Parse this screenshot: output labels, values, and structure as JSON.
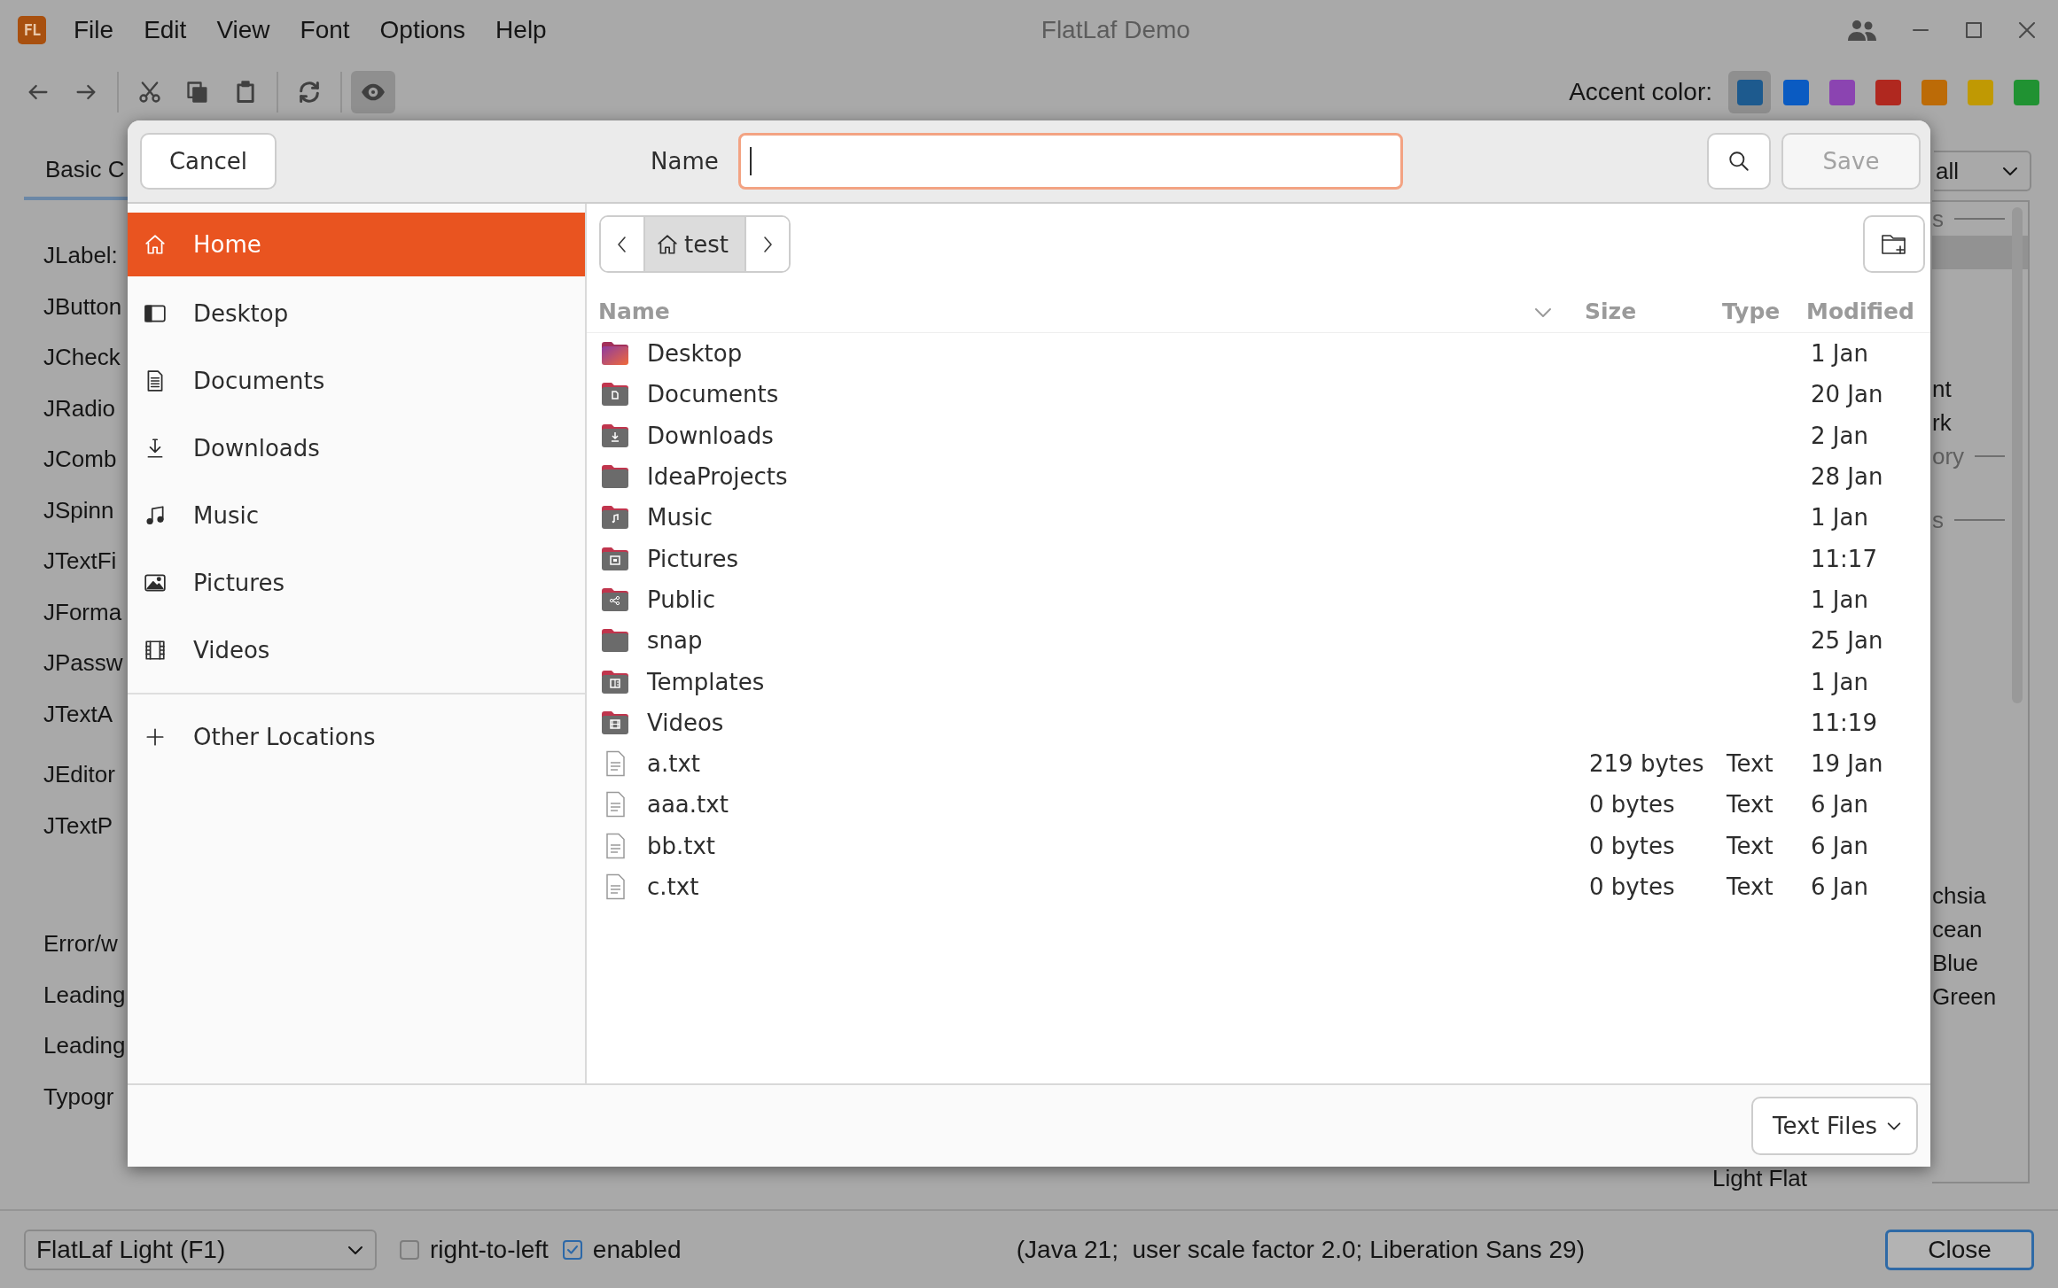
{
  "window": {
    "title": "FlatLaf Demo",
    "logo": "FL"
  },
  "menu": [
    "File",
    "Edit",
    "View",
    "Font",
    "Options",
    "Help"
  ],
  "toolbar": [
    [
      {
        "kind": "back",
        "selected": false
      },
      {
        "kind": "forward",
        "selected": false
      }
    ],
    [
      {
        "kind": "cut",
        "selected": false
      },
      {
        "kind": "copy",
        "selected": false
      },
      {
        "kind": "paste",
        "selected": false
      }
    ],
    [
      {
        "kind": "refresh",
        "selected": false
      }
    ],
    [
      {
        "kind": "eye",
        "selected": true
      }
    ]
  ],
  "accent": {
    "label": "Accent color:",
    "colors": [
      {
        "color": "#1d5a8e",
        "selected": true
      },
      {
        "color": "#0a5bc2",
        "selected": false
      },
      {
        "color": "#8b44b1",
        "selected": false
      },
      {
        "color": "#b0281f",
        "selected": false
      },
      {
        "color": "#bc6b07",
        "selected": false
      },
      {
        "color": "#c09903",
        "selected": false
      },
      {
        "color": "#209232",
        "selected": false
      }
    ]
  },
  "tabs": [
    {
      "label": "Basic C",
      "selected": true
    }
  ],
  "labels": [
    [
      "JLabel:",
      "JButton",
      "JCheck",
      "JRadio",
      "JComb",
      "JSpinn",
      "JTextFi",
      "JForma",
      "JPassw",
      "JTextA"
    ],
    [
      "JEditor",
      "JTextP"
    ],
    [
      "Error/w",
      "Leading",
      "Leading"
    ],
    [
      "Typogr"
    ]
  ],
  "right_panel": {
    "combo": "all",
    "groups": [
      [
        {
          "kind": "heading",
          "text": "s",
          "selected": false
        },
        {
          "kind": "item",
          "selected": true
        }
      ],
      [
        {
          "kind": "item",
          "text": "nt",
          "selected": false
        },
        {
          "kind": "item",
          "text": "rk",
          "selected": false
        },
        {
          "kind": "heading",
          "text": "ory",
          "selected": false
        }
      ],
      [
        {
          "kind": "heading",
          "text": "s",
          "selected": false
        }
      ],
      [
        {
          "kind": "item",
          "text": "chsia",
          "selected": false
        },
        {
          "kind": "item",
          "text": "cean",
          "selected": false
        },
        {
          "kind": "item",
          "text": "Blue",
          "selected": false
        },
        {
          "kind": "item",
          "text": "Green",
          "selected": false
        }
      ]
    ],
    "footer_item": "Light Flat"
  },
  "status_bar": {
    "theme": "FlatLaf Light (F1)",
    "checks": [
      {
        "label": "right-to-left",
        "checked": false
      },
      {
        "label": "enabled",
        "checked": true
      }
    ],
    "info": "(Java 21;  user scale factor 2.0; Liberation Sans 29)",
    "close": "Close"
  },
  "dialog": {
    "cancel": "Cancel",
    "name_label": "Name",
    "name_field": {
      "focused": true
    },
    "save": {
      "label": "Save",
      "disabled": true
    },
    "places": [
      {
        "label": "Home",
        "kind": "home",
        "selected": true
      },
      {
        "label": "Desktop",
        "kind": "desktop",
        "selected": false
      },
      {
        "label": "Documents",
        "kind": "documents",
        "selected": false
      },
      {
        "label": "Downloads",
        "kind": "downloads",
        "selected": false
      },
      {
        "label": "Music",
        "kind": "music",
        "selected": false
      },
      {
        "label": "Pictures",
        "kind": "pictures",
        "selected": false
      },
      {
        "label": "Videos",
        "kind": "videos",
        "selected": false
      }
    ],
    "other_locations": "Other Locations",
    "path": [
      "test"
    ],
    "columns": [
      {
        "label": "Name",
        "sorted": true
      },
      {
        "label": "Size",
        "sorted": false
      },
      {
        "label": "Type",
        "sorted": false
      },
      {
        "label": "Modified",
        "sorted": false
      }
    ],
    "files": [
      {
        "name": "Desktop",
        "kind": "desktop",
        "modified": "1 Jan"
      },
      {
        "name": "Documents",
        "kind": "documents",
        "modified": "20 Jan"
      },
      {
        "name": "Downloads",
        "kind": "downloads",
        "modified": "2 Jan"
      },
      {
        "name": "IdeaProjects",
        "kind": "folder",
        "modified": "28 Jan"
      },
      {
        "name": "Music",
        "kind": "music",
        "modified": "1 Jan"
      },
      {
        "name": "Pictures",
        "kind": "pictures",
        "modified": "11:17"
      },
      {
        "name": "Public",
        "kind": "public",
        "modified": "1 Jan"
      },
      {
        "name": "snap",
        "kind": "folder",
        "modified": "25 Jan"
      },
      {
        "name": "Templates",
        "kind": "templates",
        "modified": "1 Jan"
      },
      {
        "name": "Videos",
        "kind": "videos",
        "modified": "11:19"
      },
      {
        "name": "a.txt",
        "kind": "text",
        "size": "219 bytes",
        "type": "Text",
        "modified": "19 Jan"
      },
      {
        "name": "aaa.txt",
        "kind": "text",
        "size": "0 bytes",
        "type": "Text",
        "modified": "6 Jan"
      },
      {
        "name": "bb.txt",
        "kind": "text",
        "size": "0 bytes",
        "type": "Text",
        "modified": "6 Jan"
      },
      {
        "name": "c.txt",
        "kind": "text",
        "size": "0 bytes",
        "type": "Text",
        "modified": "6 Jan"
      }
    ],
    "filter": "Text Files"
  }
}
